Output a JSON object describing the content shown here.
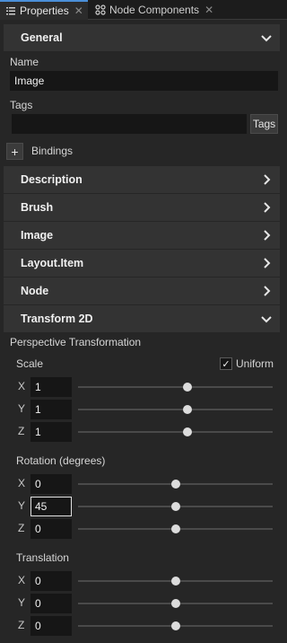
{
  "tabs": [
    {
      "label": "Properties",
      "icon": "list-icon",
      "close": "✕"
    },
    {
      "label": "Node Components",
      "icon": "components-icon",
      "close": "✕"
    }
  ],
  "sections": {
    "general": "General",
    "description": "Description",
    "brush": "Brush",
    "image": "Image",
    "layout_item": "Layout.Item",
    "node": "Node",
    "transform2d": "Transform 2D"
  },
  "general": {
    "name_label": "Name",
    "name_value": "Image",
    "tags_label": "Tags",
    "tags_value": "",
    "tags_button": "Tags",
    "add_binding": "+",
    "bindings_label": "Bindings"
  },
  "transform": {
    "perspective_label": "Perspective Transformation",
    "scale_label": "Scale",
    "uniform_label": "Uniform",
    "uniform_checked": true,
    "uniform_check": "✓",
    "scale": {
      "x": "1",
      "y": "1",
      "z": "1",
      "x_level": 0.56,
      "y_level": 0.56,
      "z_level": 0.56
    },
    "rotation_label": "Rotation (degrees)",
    "rotation": {
      "x": "0",
      "y": "45",
      "z": "0",
      "x_level": 0.5,
      "y_level": 0.5,
      "z_level": 0.5
    },
    "translation_label": "Translation",
    "translation": {
      "x": "0",
      "y": "0",
      "z": "0",
      "x_level": 0.5,
      "y_level": 0.5,
      "z_level": 0.5
    },
    "axis_x": "X",
    "axis_y": "Y",
    "axis_z": "Z"
  },
  "colors": {
    "accent": "#4a8fd8",
    "panel_bg": "#262626",
    "header_bg": "#333333",
    "field_bg": "#161616"
  }
}
